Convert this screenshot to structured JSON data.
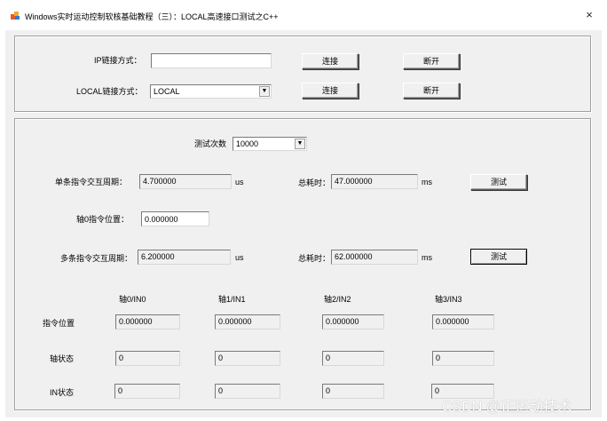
{
  "window": {
    "title": "Windows实时运动控制软核基础教程（三）：LOCAL高速接口测试之C++",
    "close_glyph": "×"
  },
  "connect": {
    "ip_label": "IP链接方式：",
    "ip_value": "",
    "local_label": "LOCAL链接方式：",
    "local_value": "LOCAL",
    "connect_label": "连接",
    "disconnect_label": "断开"
  },
  "test": {
    "count_label": "测试次数",
    "count_value": "10000",
    "single": {
      "period_label": "单条指令交互周期：",
      "period_value": "4.700000",
      "period_unit": "us",
      "total_label": "总耗时：",
      "total_value": "47.000000",
      "total_unit": "ms",
      "button": "测试"
    },
    "axis0_pos_label": "轴0指令位置：",
    "axis0_pos_value": "0.000000",
    "multi": {
      "period_label": "多条指令交互周期：",
      "period_value": "6.200000",
      "period_unit": "us",
      "total_label": "总耗时：",
      "total_value": "62.000000",
      "total_unit": "ms",
      "button": "测试"
    }
  },
  "axes": {
    "headers": [
      "轴0/IN0",
      "轴1/IN1",
      "轴2/IN2",
      "轴3/IN3"
    ],
    "rows": [
      {
        "label": "指令位置",
        "values": [
          "0.000000",
          "0.000000",
          "0.000000",
          "0.000000"
        ]
      },
      {
        "label": "轴状态",
        "values": [
          "0",
          "0",
          "0",
          "0"
        ]
      },
      {
        "label": "IN状态",
        "values": [
          "0",
          "0",
          "0",
          "0"
        ]
      }
    ]
  },
  "watermark": "CSDN @正运动技术",
  "icons": {
    "app": "app-icon",
    "dropdown": "dropdown-arrow-icon",
    "close": "close-icon"
  }
}
